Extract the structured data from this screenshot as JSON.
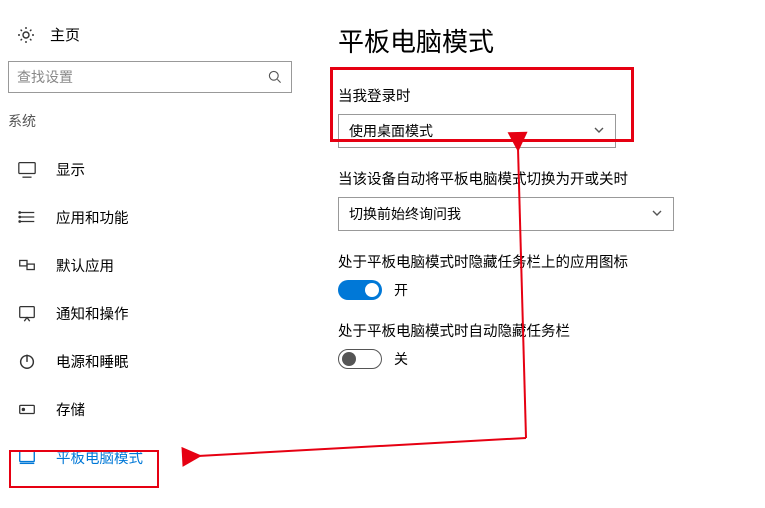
{
  "sidebar": {
    "home_label": "主页",
    "search_placeholder": "查找设置",
    "section_label": "系统",
    "items": [
      {
        "label": "显示"
      },
      {
        "label": "应用和功能"
      },
      {
        "label": "默认应用"
      },
      {
        "label": "通知和操作"
      },
      {
        "label": "电源和睡眠"
      },
      {
        "label": "存储"
      },
      {
        "label": "平板电脑模式"
      }
    ]
  },
  "main": {
    "title": "平板电脑模式",
    "signin_label": "当我登录时",
    "signin_selected": "使用桌面模式",
    "autoswitch_label": "当该设备自动将平板电脑模式切换为开或关时",
    "autoswitch_selected": "切换前始终询问我",
    "hide_icons_label": "处于平板电脑模式时隐藏任务栏上的应用图标",
    "hide_icons_state": "开",
    "hide_taskbar_label": "处于平板电脑模式时自动隐藏任务栏",
    "hide_taskbar_state": "关"
  }
}
